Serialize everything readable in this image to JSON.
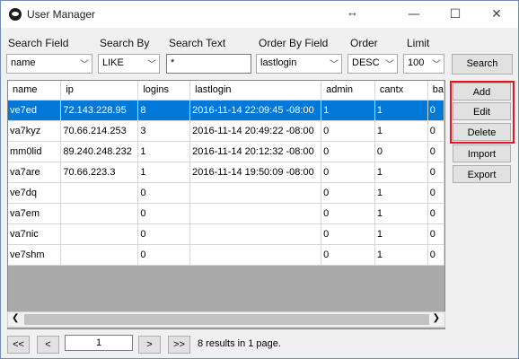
{
  "window": {
    "title": "User Manager",
    "resize_glyph": "↔",
    "minimize": "—",
    "maximize": "☐",
    "close": "✕"
  },
  "filters": {
    "search_field_label": "Search Field",
    "search_by_label": "Search By",
    "search_text_label": "Search Text",
    "order_by_field_label": "Order By Field",
    "order_label": "Order",
    "limit_label": "Limit",
    "search_field_value": "name",
    "search_by_value": "LIKE",
    "search_text_value": "*",
    "order_by_value": "lastlogin",
    "order_value": "DESC",
    "limit_value": "100",
    "search_button": "Search"
  },
  "actions": {
    "add": "Add",
    "edit": "Edit",
    "delete": "Delete",
    "import": "Import",
    "export": "Export"
  },
  "grid": {
    "columns": [
      "name",
      "ip",
      "logins",
      "lastlogin",
      "admin",
      "cantx",
      "ba"
    ],
    "rows": [
      [
        "ve7ed",
        "72.143.228.95",
        "8",
        "2016-11-14 22:09:45 -08:00",
        "1",
        "1",
        "0"
      ],
      [
        "va7kyz",
        "70.66.214.253",
        "3",
        "2016-11-14 20:49:22 -08:00",
        "0",
        "1",
        "0"
      ],
      [
        "mm0lid",
        "89.240.248.232",
        "1",
        "2016-11-14 20:12:32 -08:00",
        "0",
        "0",
        "0"
      ],
      [
        "va7are",
        "70.66.223.3",
        "1",
        "2016-11-14 19:50:09 -08:00",
        "0",
        "1",
        "0"
      ],
      [
        "ve7dq",
        "",
        "0",
        "",
        "0",
        "1",
        "0"
      ],
      [
        "va7em",
        "",
        "0",
        "",
        "0",
        "1",
        "0"
      ],
      [
        "va7nic",
        "",
        "0",
        "",
        "0",
        "1",
        "0"
      ],
      [
        "ve7shm",
        "",
        "0",
        "",
        "0",
        "1",
        "0"
      ]
    ],
    "selected_row": 0
  },
  "pager": {
    "first": "<<",
    "prev": "<",
    "page": "1",
    "next": ">",
    "last": ">>",
    "summary": "8 results in 1 page."
  },
  "colors": {
    "selection": "#0078d7",
    "highlight_border": "#e8131f"
  }
}
